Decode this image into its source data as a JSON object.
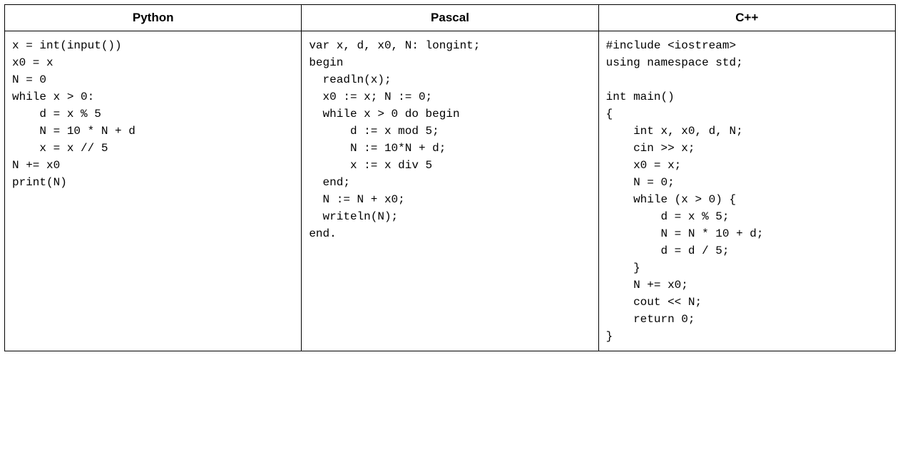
{
  "table": {
    "headers": [
      "Python",
      "Pascal",
      "C++"
    ],
    "code": {
      "python": "x = int(input())\nx0 = x\nN = 0\nwhile x > 0:\n    d = x % 5\n    N = 10 * N + d\n    x = x // 5\nN += x0\nprint(N)",
      "pascal": "var x, d, x0, N: longint;\nbegin\n  readln(x);\n  x0 := x; N := 0;\n  while x > 0 do begin\n      d := x mod 5;\n      N := 10*N + d;\n      x := x div 5\n  end;\n  N := N + x0;\n  writeln(N);\nend.",
      "cpp": "#include <iostream>\nusing namespace std;\n\nint main()\n{\n    int x, x0, d, N;\n    cin >> x;\n    x0 = x;\n    N = 0;\n    while (x > 0) {\n        d = x % 5;\n        N = N * 10 + d;\n        d = d / 5;\n    }\n    N += x0;\n    cout << N;\n    return 0;\n}"
    }
  }
}
